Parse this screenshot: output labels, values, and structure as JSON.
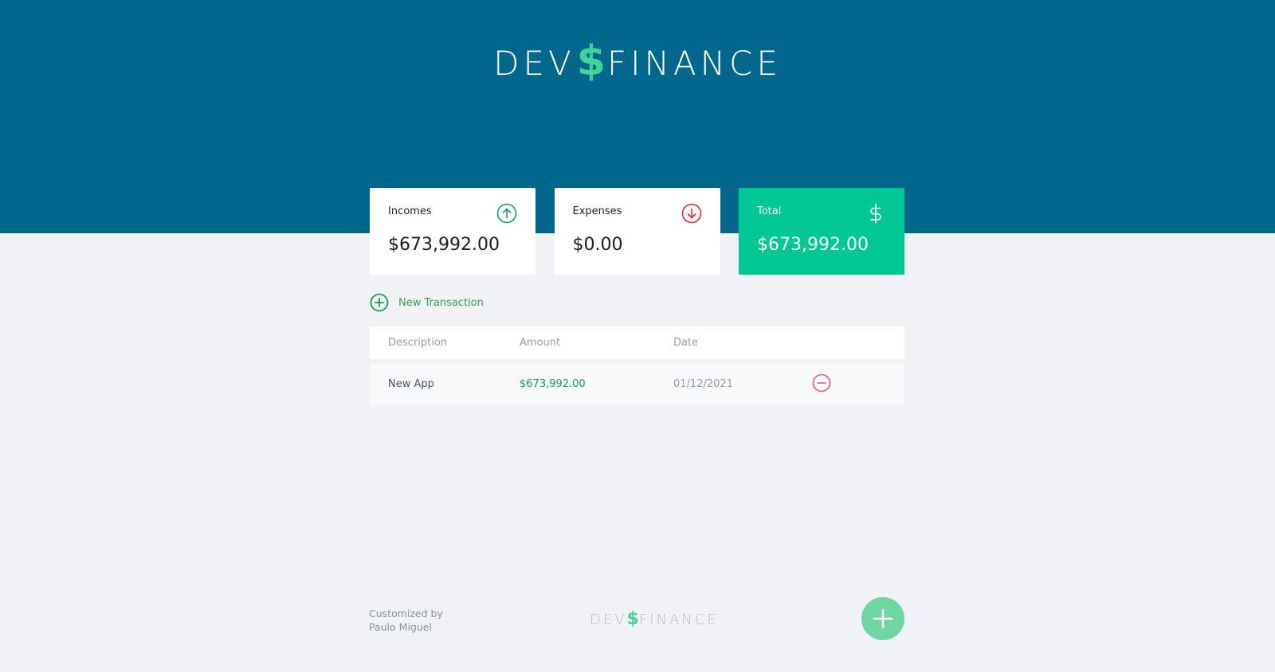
{
  "header": {
    "logo_left": "DEV",
    "logo_symbol": "$",
    "logo_right": "FINANCE"
  },
  "cards": {
    "incomes": {
      "label": "Incomes",
      "value": "$673,992.00",
      "icon": "arrow-up-circle-icon"
    },
    "expenses": {
      "label": "Expenses",
      "value": "$0.00",
      "icon": "arrow-down-circle-icon"
    },
    "total": {
      "label": "Total",
      "value": "$673,992.00",
      "icon": "dollar-sign-icon"
    }
  },
  "new_transaction": {
    "label": "New Transaction",
    "icon": "plus-circle-icon"
  },
  "table": {
    "headers": [
      "Description",
      "Amount",
      "Date",
      ""
    ],
    "rows": [
      {
        "description": "New App",
        "amount": "$673,992.00",
        "date": "01/12/2021",
        "action_icon": "minus-circle-icon"
      }
    ]
  },
  "footer": {
    "credit_line1": "Customized by",
    "credit_line2": "Paulo Miguel",
    "logo_left": "DEV",
    "logo_symbol": "$",
    "logo_right": "FINANCE",
    "fab_icon": "plus-icon"
  },
  "colors": {
    "header_bg": "#02678c",
    "page_bg": "#f0f2f5",
    "total_card": "#00c793",
    "income_green": "#12a454",
    "expense_red": "#e92929",
    "accent_green": "#3dd598",
    "fab": "#6ed6a0"
  }
}
